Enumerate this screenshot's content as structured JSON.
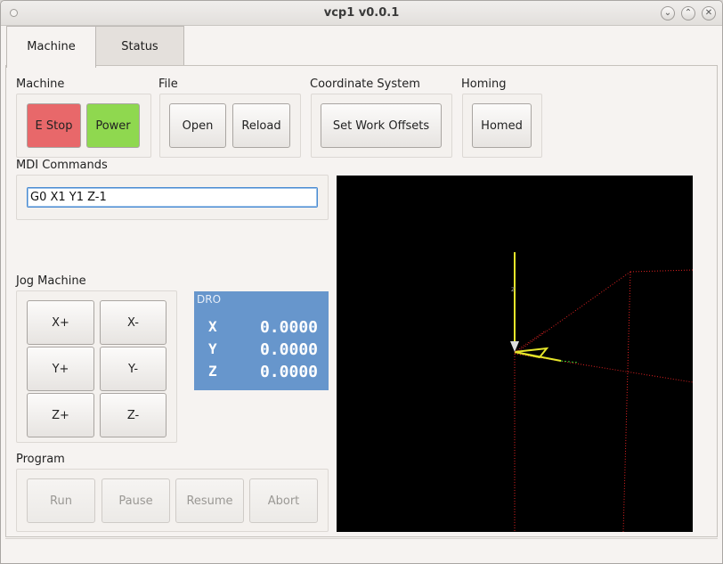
{
  "window": {
    "title": "vcp1 v0.0.1"
  },
  "tabs": [
    {
      "label": "Machine",
      "active": true
    },
    {
      "label": "Status",
      "active": false
    }
  ],
  "machine": {
    "label": "Machine",
    "estop_label": "E Stop",
    "power_label": "Power",
    "estop_color": "#e8686a",
    "power_color": "#8fd84f"
  },
  "file": {
    "label": "File",
    "open_label": "Open",
    "reload_label": "Reload"
  },
  "coordinate_system": {
    "label": "Coordinate System",
    "set_offsets_label": "Set Work Offsets"
  },
  "homing": {
    "label": "Homing",
    "homed_label": "Homed"
  },
  "mdi": {
    "label": "MDI Commands",
    "value": "G0 X1 Y1 Z-1"
  },
  "jog": {
    "label": "Jog Machine",
    "buttons": [
      "X+",
      "X-",
      "Y+",
      "Y-",
      "Z+",
      "Z-"
    ]
  },
  "dro": {
    "title": "DRO",
    "color": "#6796cc",
    "rows": [
      {
        "axis": "X",
        "value": "0.0000"
      },
      {
        "axis": "Y",
        "value": "0.0000"
      },
      {
        "axis": "Z",
        "value": "0.0000"
      }
    ]
  },
  "program": {
    "label": "Program",
    "buttons": [
      "Run",
      "Pause",
      "Resume",
      "Abort"
    ]
  }
}
